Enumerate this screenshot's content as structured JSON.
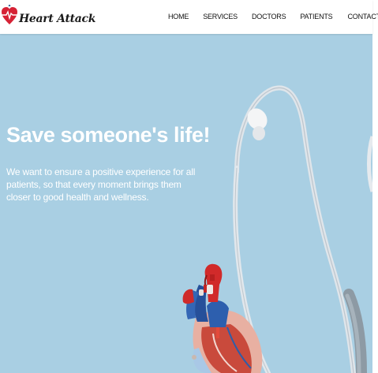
{
  "brand": {
    "name": "Heart Attack",
    "logo_icon": "heart-pulse-icon",
    "accent_color": "#d62235"
  },
  "nav": {
    "items": [
      {
        "label": "HOME"
      },
      {
        "label": "SERVICES"
      },
      {
        "label": "DOCTORS"
      },
      {
        "label": "PATIENTS"
      },
      {
        "label": "CONTACT"
      }
    ]
  },
  "hero": {
    "title": "Save someone's life!",
    "text": "We want to ensure a positive experience for all patients, so that every moment brings them closer to good health and wellness.",
    "background_color": "#a9cfe3",
    "image_icons": [
      "stethoscope-icon",
      "anatomical-heart-icon"
    ]
  }
}
